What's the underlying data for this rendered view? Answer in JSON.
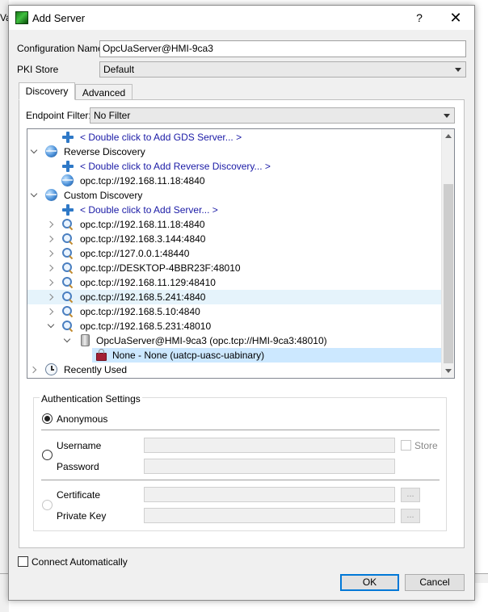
{
  "background": {
    "left_text": "Va"
  },
  "dialog": {
    "title": "Add Server",
    "help_label": "?",
    "close_label": "✕"
  },
  "config": {
    "name_label": "Configuration Name",
    "name_value": "OpcUaServer@HMI-9ca3",
    "pki_label": "PKI Store",
    "pki_value": "Default"
  },
  "tabs": [
    {
      "label": "Discovery",
      "active": true
    },
    {
      "label": "Advanced",
      "active": false
    }
  ],
  "endpoint_filter": {
    "label": "Endpoint Filter:",
    "value": "No Filter"
  },
  "tree": {
    "rows": [
      {
        "text": "< Double click to Add GDS Server... >",
        "icon": "plus-icon",
        "link": true
      },
      {
        "text": "Reverse Discovery",
        "icon": "globe-icon",
        "expander": "open"
      },
      {
        "text": "< Double click to Add Reverse Discovery... >",
        "icon": "plus-icon",
        "link": true
      },
      {
        "text": "opc.tcp://192.168.11.18:4840",
        "icon": "globe-icon"
      },
      {
        "text": "Custom Discovery",
        "icon": "globe-icon",
        "expander": "open"
      },
      {
        "text": "< Double click to Add Server... >",
        "icon": "plus-icon",
        "link": true
      },
      {
        "text": "opc.tcp://192.168.11.18:4840",
        "icon": "search-icon",
        "expander": "closed"
      },
      {
        "text": "opc.tcp://192.168.3.144:4840",
        "icon": "search-icon",
        "expander": "closed"
      },
      {
        "text": "opc.tcp://127.0.0.1:48440",
        "icon": "search-icon",
        "expander": "closed"
      },
      {
        "text": "opc.tcp://DESKTOP-4BBR23F:48010",
        "icon": "search-icon",
        "expander": "closed"
      },
      {
        "text": "opc.tcp://192.168.11.129:48410",
        "icon": "search-icon",
        "expander": "closed"
      },
      {
        "text": "opc.tcp://192.168.5.241:4840",
        "icon": "search-icon",
        "expander": "closed",
        "hover": true
      },
      {
        "text": "opc.tcp://192.168.5.10:4840",
        "icon": "search-icon",
        "expander": "closed"
      },
      {
        "text": "opc.tcp://192.168.5.231:48010",
        "icon": "search-icon",
        "expander": "open"
      },
      {
        "text": "OpcUaServer@HMI-9ca3 (opc.tcp://HMI-9ca3:48010)",
        "icon": "server-icon",
        "expander": "open"
      },
      {
        "text": "None - None (uatcp-uasc-uabinary)",
        "icon": "lock-icon",
        "selected": true
      },
      {
        "text": "Recently Used",
        "icon": "clock-icon",
        "expander": "closed"
      }
    ]
  },
  "auth": {
    "title": "Authentication Settings",
    "anonymous_label": "Anonymous",
    "username_label": "Username",
    "password_label": "Password",
    "store_label": "Store",
    "certificate_label": "Certificate",
    "private_key_label": "Private Key",
    "browse_label": "..."
  },
  "footer": {
    "connect_auto_label": "Connect Automatically",
    "ok_label": "OK",
    "cancel_label": "Cancel"
  }
}
